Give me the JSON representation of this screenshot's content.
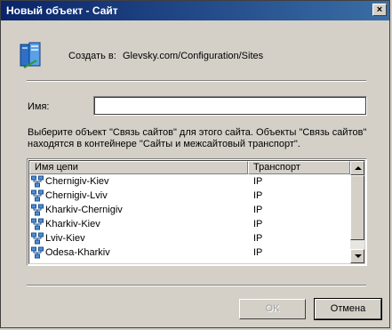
{
  "window": {
    "title": "Новый объект - Сайт",
    "close_label": "×"
  },
  "create": {
    "label": "Создать в:",
    "path": "Glevsky.com/Configuration/Sites"
  },
  "name_field": {
    "label": "Имя:",
    "value": ""
  },
  "description": "Выберите объект \"Связь сайтов\" для этого сайта. Объекты \"Связь сайтов\" находятся в контейнере \"Сайты и межсайтовый транспорт\".",
  "table": {
    "columns": [
      "Имя цепи",
      "Транспорт"
    ],
    "rows": [
      {
        "name": "Chernigiv-Kiev",
        "transport": "IP"
      },
      {
        "name": "Chernigiv-Lviv",
        "transport": "IP"
      },
      {
        "name": "Kharkiv-Chernigiv",
        "transport": "IP"
      },
      {
        "name": "Kharkiv-Kiev",
        "transport": "IP"
      },
      {
        "name": "Lviv-Kiev",
        "transport": "IP"
      },
      {
        "name": "Odesa-Kharkiv",
        "transport": "IP"
      }
    ]
  },
  "buttons": {
    "ok": "OK",
    "cancel": "Отмена"
  }
}
